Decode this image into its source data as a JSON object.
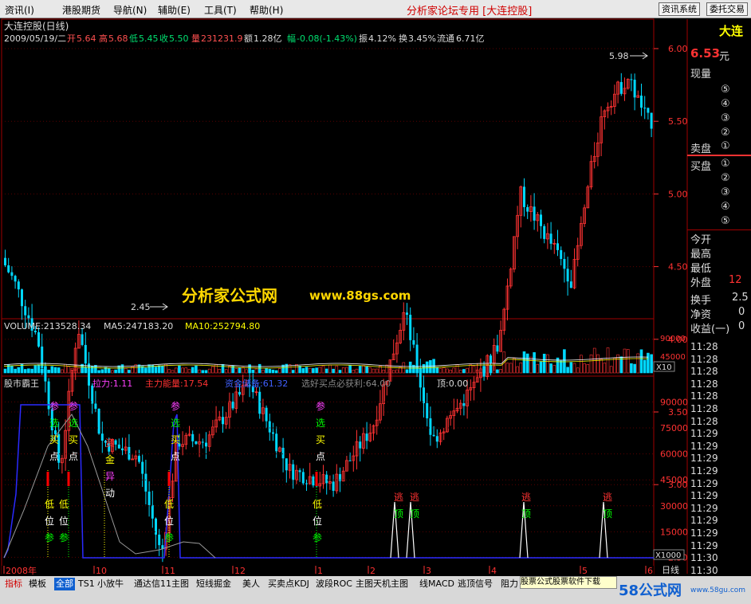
{
  "menubar": {
    "items": [
      "资讯(I)",
      "港股期货",
      "导航(N)",
      "辅助(E)",
      "工具(T)",
      "帮助(H)"
    ],
    "app_title": "分析家论坛专用 [大连控股]",
    "right_buttons": [
      "资讯系统",
      "委托交易"
    ]
  },
  "chart_header": {
    "stock_name": "大连控股(日线)",
    "date": "2009/05/19/二",
    "open_label": "开",
    "open": "5.64",
    "high_label": "高",
    "high": "5.68",
    "low_label": "低",
    "low": "5.45",
    "close_label": "收",
    "close": "5.50",
    "volume_label": "量",
    "volume": "231231.9",
    "amount_label": "额",
    "amount": "1.28亿",
    "change_label": "幅",
    "change": "-0.08(-1.43%)",
    "amplitude_label": "振",
    "amplitude": "4.12%",
    "turnover_label": "换",
    "turnover": "3.45%",
    "float_label": "流通",
    "float": "6.71亿"
  },
  "price_axis": [
    "6.00",
    "5.50",
    "5.00",
    "4.50",
    "4.00",
    "3.50",
    "3.00",
    "2.50"
  ],
  "annotations": {
    "high_mark": "5.98",
    "low_mark": "2.45",
    "watermark": "分析家公式网",
    "watermark_url": "www.88gs.com"
  },
  "volume_panel": {
    "volume": "VOLUME:213528.34",
    "ma5": "MA5:247183.20",
    "ma10": "MA10:252794.80",
    "axis": [
      "90000",
      "45000"
    ],
    "unit": "X10"
  },
  "indicator_panel": {
    "name": "股市霸王",
    "lali": "拉力:1.11",
    "zhuli": "主力能量:17.54",
    "zijin": "资金储备:61.32",
    "xuanhao": "选好买点必获利:64.00",
    "ding": "顶:0.00",
    "axis": [
      "90000",
      "75000",
      "60000",
      "45000",
      "30000",
      "15000"
    ],
    "unit": "X1000"
  },
  "signals": {
    "buy_chars": [
      "参",
      "选",
      "买",
      "点"
    ],
    "low_chars": [
      "低",
      "位",
      "参"
    ],
    "fund_chars": [
      "资",
      "金",
      "异",
      "动"
    ],
    "escape_chars": [
      "逃",
      "顶"
    ]
  },
  "time_axis": {
    "labels": [
      "2008年",
      "10",
      "11",
      "12",
      "1",
      "2",
      "3",
      "4",
      "5",
      "6"
    ],
    "period": "日线"
  },
  "sidebar": {
    "header": "大连",
    "price": "6.53",
    "price_unit": "元",
    "now_vol": "现量",
    "sell_label": "卖盘",
    "buy_label": "买盘",
    "levels_sell": [
      "⑤",
      "④",
      "③",
      "②",
      "①"
    ],
    "levels_buy": [
      "①",
      "②",
      "③",
      "④",
      "⑤"
    ],
    "stats": [
      "今开",
      "最高",
      "最低",
      "外盘",
      "换手",
      "净资",
      "收益(一)"
    ],
    "stat_vals": [
      "",
      "",
      "",
      "12",
      "2.5",
      "0",
      "0"
    ],
    "times": [
      "11:28",
      "11:28",
      "11:28",
      "11:28",
      "11:28",
      "11:28",
      "11:28",
      "11:29",
      "11:29",
      "11:29",
      "11:29",
      "11:29",
      "11:29",
      "11:29",
      "11:29",
      "11:29",
      "11:29",
      "11:30",
      "11:30"
    ]
  },
  "tabs": {
    "items": [
      "指标",
      "模板",
      "全部",
      "TS1",
      "小放牛",
      "通达信11主图",
      "短线掘金",
      "美人",
      "买卖点KDJ",
      "波段ROC",
      "主图天机主图",
      "线MACD",
      "逃顶信号",
      "阻力"
    ],
    "ad_text": "股票公式股票软件下载",
    "logo_main": "58公式网",
    "logo_url": "www.58gu.com"
  },
  "colors": {
    "up": "#ff3232",
    "down": "#00d8ff",
    "ma_white": "#ffffff",
    "ma_yellow": "#ffff00",
    "accent_red": "#d00000",
    "watermark": "#ffd700"
  }
}
